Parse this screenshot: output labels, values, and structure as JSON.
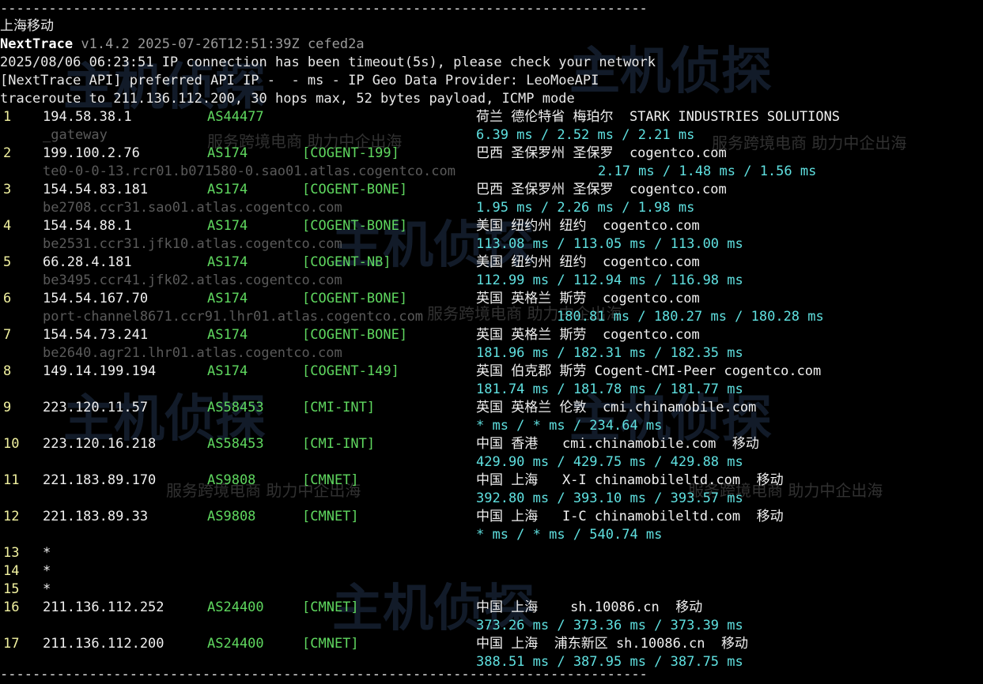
{
  "separator": "--------------------------------------------------------------------------------",
  "location_title": "上海移动",
  "header": {
    "app_name": "NextTrace",
    "version_info": "v1.4.2 2025-07-26T12:51:39Z cefed2a",
    "timeout_msg": "2025/08/06 06:23:51 IP connection has been timeout(5s), please check your network",
    "api_line": "[NextTrace API] preferred API IP -  - ms - IP Geo Data Provider: LeoMoeAPI",
    "trace_line": "traceroute to 211.136.112.200, 30 hops max, 52 bytes payload, ICMP mode"
  },
  "hops": [
    {
      "num": "1",
      "ip": "194.58.38.1",
      "asn": "AS44477",
      "tag": "",
      "geo": "荷兰 德伦特省 梅珀尔  STARK INDUSTRIES SOLUTIONS",
      "host": "_gateway",
      "rtt": "6.39 ms / 2.52 ms / 2.21 ms"
    },
    {
      "num": "2",
      "ip": "199.100.2.76",
      "asn": "AS174",
      "tag": "[COGENT-199]",
      "geo": "巴西 圣保罗州 圣保罗  cogentco.com",
      "host": "te0-0-0-13.rcr01.b071580-0.sao01.atlas.cogentco.com",
      "rtt": "2.17 ms / 1.48 ms / 1.56 ms"
    },
    {
      "num": "3",
      "ip": "154.54.83.181",
      "asn": "AS174",
      "tag": "[COGENT-BONE]",
      "geo": "巴西 圣保罗州 圣保罗  cogentco.com",
      "host": "be2708.ccr31.sao01.atlas.cogentco.com",
      "rtt": "1.95 ms / 2.26 ms / 1.98 ms"
    },
    {
      "num": "4",
      "ip": "154.54.88.1",
      "asn": "AS174",
      "tag": "[COGENT-BONE]",
      "geo": "美国 纽约州 纽约  cogentco.com",
      "host": "be2531.ccr31.jfk10.atlas.cogentco.com",
      "rtt": "113.08 ms / 113.05 ms / 113.00 ms"
    },
    {
      "num": "5",
      "ip": "66.28.4.181",
      "asn": "AS174",
      "tag": "[COGENT-NB]",
      "geo": "美国 纽约州 纽约  cogentco.com",
      "host": "be3495.ccr41.jfk02.atlas.cogentco.com",
      "rtt": "112.99 ms / 112.94 ms / 116.98 ms"
    },
    {
      "num": "6",
      "ip": "154.54.167.70",
      "asn": "AS174",
      "tag": "[COGENT-BONE]",
      "geo": "英国 英格兰 斯劳  cogentco.com",
      "host": "port-channel8671.ccr91.lhr01.atlas.cogentco.com",
      "rtt": "180.81 ms / 180.27 ms / 180.28 ms"
    },
    {
      "num": "7",
      "ip": "154.54.73.241",
      "asn": "AS174",
      "tag": "[COGENT-BONE]",
      "geo": "英国 英格兰 斯劳  cogentco.com",
      "host": "be2640.agr21.lhr01.atlas.cogentco.com",
      "rtt": "181.96 ms / 182.31 ms / 182.35 ms"
    },
    {
      "num": "8",
      "ip": "149.14.199.194",
      "asn": "AS174",
      "tag": "[COGENT-149]",
      "geo": "英国 伯克郡 斯劳 Cogent-CMI-Peer cogentco.com",
      "host": "",
      "rtt": "181.74 ms / 181.78 ms / 181.77 ms"
    },
    {
      "num": "9",
      "ip": "223.120.11.57",
      "asn": "AS58453",
      "tag": "[CMI-INT]",
      "geo": "英国 英格兰 伦敦  cmi.chinamobile.com",
      "host": "",
      "rtt": "* ms / * ms / 234.64 ms"
    },
    {
      "num": "10",
      "ip": "223.120.16.218",
      "asn": "AS58453",
      "tag": "[CMI-INT]",
      "geo": "中国 香港   cmi.chinamobile.com  移动",
      "host": "",
      "rtt": "429.90 ms / 429.75 ms / 429.88 ms"
    },
    {
      "num": "11",
      "ip": "221.183.89.170",
      "asn": "AS9808",
      "tag": "[CMNET]",
      "geo": "中国 上海   X-I chinamobileltd.com  移动",
      "host": "",
      "rtt": "392.80 ms / 393.10 ms / 393.57 ms"
    },
    {
      "num": "12",
      "ip": "221.183.89.33",
      "asn": "AS9808",
      "tag": "[CMNET]",
      "geo": "中国 上海   I-C chinamobileltd.com  移动",
      "host": "",
      "rtt": "* ms / * ms / 540.74 ms"
    },
    {
      "num": "13",
      "ip": "*",
      "asn": "",
      "tag": "",
      "geo": "",
      "host": "",
      "rtt": ""
    },
    {
      "num": "14",
      "ip": "*",
      "asn": "",
      "tag": "",
      "geo": "",
      "host": "",
      "rtt": ""
    },
    {
      "num": "15",
      "ip": "*",
      "asn": "",
      "tag": "",
      "geo": "",
      "host": "",
      "rtt": ""
    },
    {
      "num": "16",
      "ip": "211.136.112.252",
      "asn": "AS24400",
      "tag": "[CMNET]",
      "geo": "中国 上海    sh.10086.cn  移动",
      "host": "",
      "rtt": "373.26 ms / 373.36 ms / 373.39 ms"
    },
    {
      "num": "17",
      "ip": "211.136.112.200",
      "asn": "AS24400",
      "tag": "[CMNET]",
      "geo": "中国 上海  浦东新区 sh.10086.cn  移动",
      "host": "",
      "rtt": "388.51 ms / 387.95 ms / 387.75 ms"
    }
  ],
  "watermarks": {
    "brand": "主机侦探",
    "slogan": "服务跨境电商 助力中企出海"
  },
  "colors": {
    "background": "#000000",
    "hop_number": "#f2f2a0",
    "asn_green": "#5fd75f",
    "rtt_cyan": "#5fe0e0",
    "host_gray": "#5a5a5a"
  }
}
